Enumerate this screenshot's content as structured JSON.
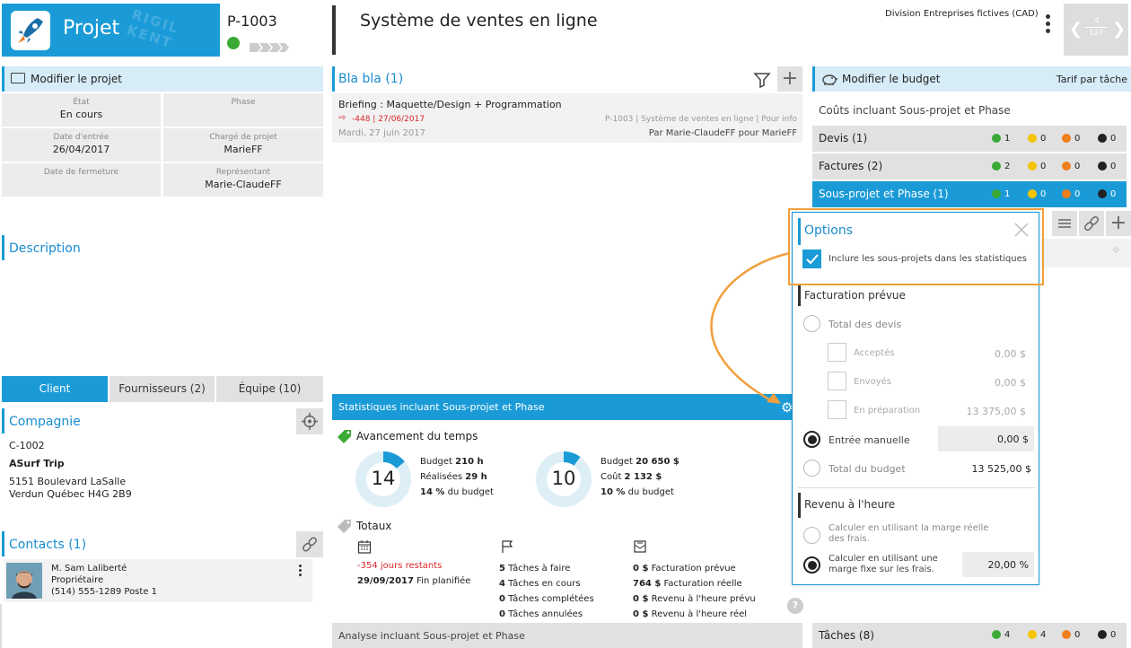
{
  "project": {
    "logo_label": "Projet",
    "logo_text": "RIGIL KENT",
    "code": "P-1003",
    "title": "Système de ventes en ligne"
  },
  "division": {
    "label": "Division",
    "value": "Entreprises fictives (CAD)"
  },
  "pager": {
    "current": "4",
    "total": "127"
  },
  "modify_project": {
    "title": "Modifier le projet",
    "fields": [
      {
        "label": "État",
        "value": "En cours"
      },
      {
        "label": "Phase",
        "value": ""
      },
      {
        "label": "Date d'entrée",
        "value": "26/04/2017"
      },
      {
        "label": "Chargé de projet",
        "value": "MarieFF"
      },
      {
        "label": "Date de fermeture",
        "value": ""
      },
      {
        "label": "Représentant",
        "value": "Marie-ClaudeFF"
      }
    ]
  },
  "description": {
    "title": "Description"
  },
  "tabs": [
    "Client",
    "Fournisseurs (2)",
    "Équipe (10)"
  ],
  "company": {
    "title": "Compagnie",
    "code": "C-1002",
    "name": "ASurf Trip",
    "address1": "5151 Boulevard LaSalle",
    "address2": "Verdun Québec  H4G 2B9"
  },
  "contacts": {
    "title": "Contacts (1)",
    "name": "M. Sam Laliberté",
    "role": "Propriétaire",
    "phone": "(514) 555-1289 Poste 1"
  },
  "blabla": {
    "title": "Bla bla (1)",
    "item": {
      "title": "Briefing : Maquette/Design + Programmation",
      "late": "-448",
      "date_red": "27/06/2017",
      "ref": "P-1003 | Système de ventes en ligne | Pour info",
      "date": "Mardi, 27 juin 2017",
      "by": "Par Marie-ClaudeFF pour MarieFF"
    }
  },
  "stats": {
    "title": "Statistiques incluant Sous-projet et Phase",
    "time_title": "Avancement du temps",
    "donut1": {
      "number": "14",
      "budget_label": "Budget",
      "budget": "210 h",
      "real_label": "Réalisées",
      "real": "29 h",
      "pct": "14 %",
      "pct_label": "du budget"
    },
    "donut2": {
      "number": "10",
      "budget_label": "Budget",
      "budget": "20 650 $",
      "cost_label": "Coût",
      "cost": "2 132 $",
      "pct": "10 %",
      "pct_label": "du budget"
    },
    "totals_title": "Totaux",
    "col1": {
      "remaining": "-354 jours restants",
      "end_date": "29/09/2017",
      "end_label": "Fin planifiée"
    },
    "col2": [
      {
        "n": "5",
        "t": "Tâches à faire"
      },
      {
        "n": "4",
        "t": "Tâches en cours"
      },
      {
        "n": "0",
        "t": "Tâches complétées"
      },
      {
        "n": "0",
        "t": "Tâches annulées"
      }
    ],
    "col3": [
      {
        "n": "0 $",
        "t": "Facturation prévue"
      },
      {
        "n": "764 $",
        "t": "Facturation réelle"
      },
      {
        "n": "0 $",
        "t": "Revenu à l'heure prévu"
      },
      {
        "n": "0 $",
        "t": "Revenu à l'heure réel"
      }
    ],
    "help": "?"
  },
  "analysis": {
    "title": "Analyse incluant Sous-projet et Phase"
  },
  "budget": {
    "title": "Modifier le budget",
    "rate": "Tarif par tâche",
    "costs_title": "Coûts incluant Sous-projet et Phase",
    "rows": [
      {
        "label": "Devis (1)",
        "counts": [
          "1",
          "0",
          "0",
          "0"
        ]
      },
      {
        "label": "Factures (2)",
        "counts": [
          "2",
          "0",
          "0",
          "0"
        ]
      },
      {
        "label": "Sous-projet et Phase (1)",
        "counts": [
          "1",
          "0",
          "0",
          "0"
        ]
      }
    ],
    "tasks": {
      "label": "Tâches (8)",
      "counts": [
        "4",
        "4",
        "0",
        "0"
      ]
    },
    "status_colors": [
      "#3aa935",
      "#f5c400",
      "#f07f1d",
      "#222222"
    ]
  },
  "options": {
    "title": "Options",
    "include_sub": "Inclure les sous-projets dans les statistiques",
    "planned_billing": "Facturation prévue",
    "total_quotes": "Total des devis",
    "accepted": "Acceptés",
    "accepted_val": "0,00 $",
    "sent": "Envoyés",
    "sent_val": "0,00 $",
    "preparing": "En préparation",
    "preparing_val": "13 375,00 $",
    "manual": "Entrée manuelle",
    "manual_val": "0,00 $",
    "budget_total": "Total du budget",
    "budget_total_val": "13 525,00 $",
    "hourly_title": "Revenu à l'heure",
    "calc_real": "Calculer en utilisant la marge réelle des frais.",
    "calc_fixed": "Calculer en utilisant une marge fixe sur les frais.",
    "fixed_val": "20,00 %"
  }
}
